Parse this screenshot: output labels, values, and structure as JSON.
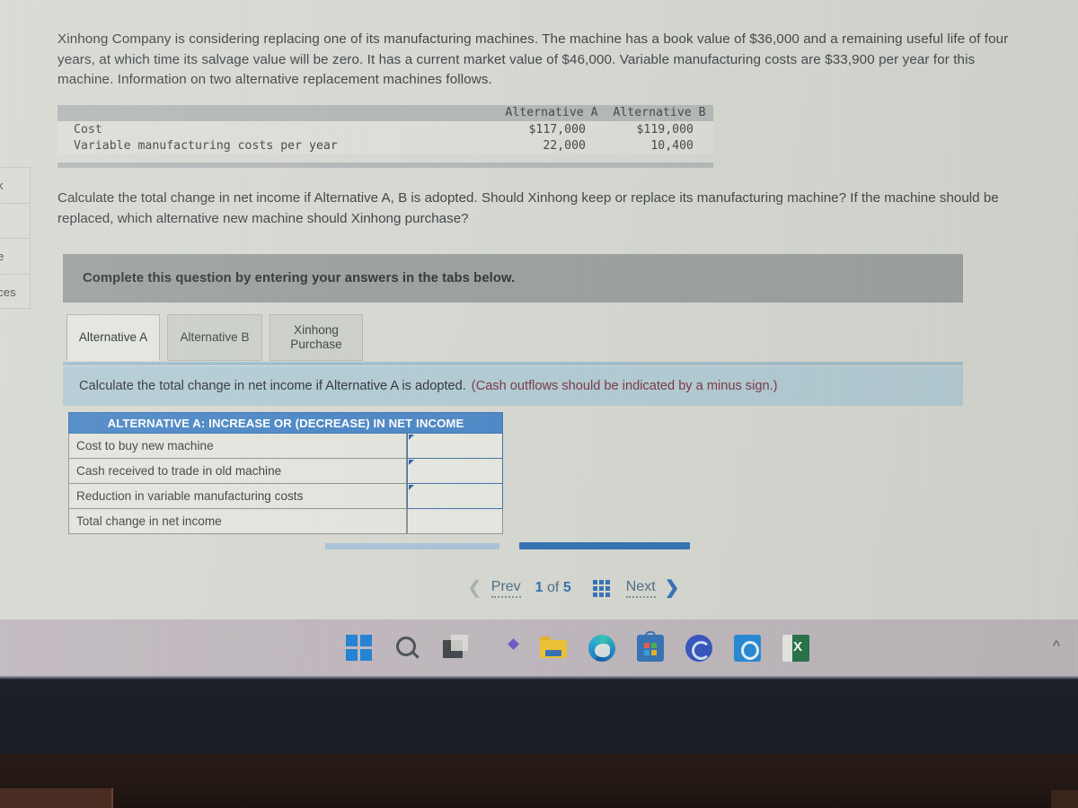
{
  "problem": {
    "statement": "Xinhong Company is considering replacing one of its manufacturing machines. The machine has a book value of $36,000 and a remaining useful life of four years, at which time its salvage value will be zero. It has a current market value of $46,000. Variable manufacturing costs are $33,900 per year for this machine. Information on two alternative replacement machines follows.",
    "requirement": "Calculate the total change in net income if Alternative A, B is adopted. Should Xinhong keep or replace its manufacturing machine? If the machine should be replaced, which alternative new machine should Xinhong purchase?"
  },
  "data_table": {
    "columns": [
      "Alternative A",
      "Alternative B"
    ],
    "rows": [
      {
        "label": "Cost",
        "a": "$117,000",
        "b": "$119,000"
      },
      {
        "label": "Variable manufacturing costs per year",
        "a": "22,000",
        "b": "10,400"
      }
    ]
  },
  "banner": {
    "complete_instruction": "Complete this question by entering your answers in the tabs below."
  },
  "tabs": [
    {
      "label": "Alternative A",
      "active": true
    },
    {
      "label": "Alternative B",
      "active": false
    },
    {
      "label_line1": "Xinhong",
      "label_line2": "Purchase",
      "active": false
    }
  ],
  "tab_instruction": {
    "main": "Calculate the total change in net income if Alternative A is adopted.",
    "hint": "(Cash outflows should be indicated by a minus sign.)"
  },
  "answer_table": {
    "header": "ALTERNATIVE A: INCREASE OR (DECREASE) IN NET INCOME",
    "rows": [
      {
        "label": "Cost to buy new machine",
        "value": ""
      },
      {
        "label": "Cash received to trade in old machine",
        "value": ""
      },
      {
        "label": "Reduction in variable manufacturing costs",
        "value": ""
      },
      {
        "label": "Total change in net income",
        "value": ""
      }
    ]
  },
  "footer_nav": {
    "prev_label": "Prev",
    "page_current": "1",
    "page_of": "of",
    "page_total": "5",
    "next_label": "Next",
    "grid_icon": "grid-menu-icon"
  },
  "sidebar_partial": {
    "items": [
      "k",
      "",
      "e",
      "ces"
    ]
  },
  "taskbar": {
    "icons": [
      "windows-start-icon",
      "search-icon",
      "task-view-icon",
      "chat-icon",
      "file-explorer-icon",
      "microsoft-edge-icon",
      "microsoft-store-icon",
      "cortana-icon",
      "blue-app-icon",
      "excel-icon"
    ],
    "overflow_icon": "chevron-up-icon"
  },
  "colors": {
    "accent_blue": "#4a87c6",
    "banner_gray": "#9ba09e",
    "banner_blue": "#b2ccd5",
    "hint_red": "#7a3040",
    "page_bg": "#d7d9d2"
  }
}
